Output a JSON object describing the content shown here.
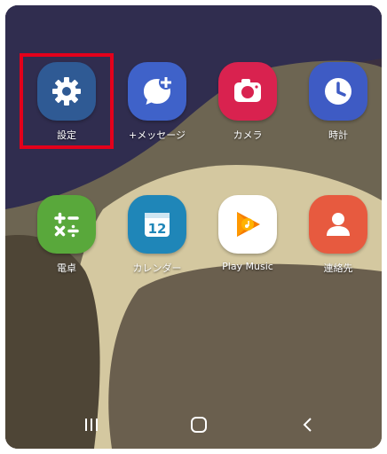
{
  "apps": [
    {
      "id": "settings",
      "label": "設定",
      "icon": "gear-icon",
      "color": "#2f5a94"
    },
    {
      "id": "messages",
      "label": "+メッセージ",
      "icon": "chat-plus-icon",
      "color": "#3f62c9"
    },
    {
      "id": "camera",
      "label": "カメラ",
      "icon": "camera-icon",
      "color": "#d9224f"
    },
    {
      "id": "clock",
      "label": "時計",
      "icon": "clock-icon",
      "color": "#3e5bc4"
    },
    {
      "id": "calculator",
      "label": "電卓",
      "icon": "calculator-icon",
      "color": "#59a83b"
    },
    {
      "id": "calendar",
      "label": "カレンダー",
      "icon": "calendar-icon",
      "color": "#1f86b8",
      "day": "12"
    },
    {
      "id": "playmusic",
      "label": "Play Music",
      "icon": "play-music-icon",
      "color": "#ffffff"
    },
    {
      "id": "contacts",
      "label": "連絡先",
      "icon": "contact-icon",
      "color": "#e75a3f"
    }
  ],
  "highlight_color": "#e3001b",
  "navbar": {
    "recent": "recent-apps-icon",
    "home": "home-icon",
    "back": "back-icon"
  }
}
